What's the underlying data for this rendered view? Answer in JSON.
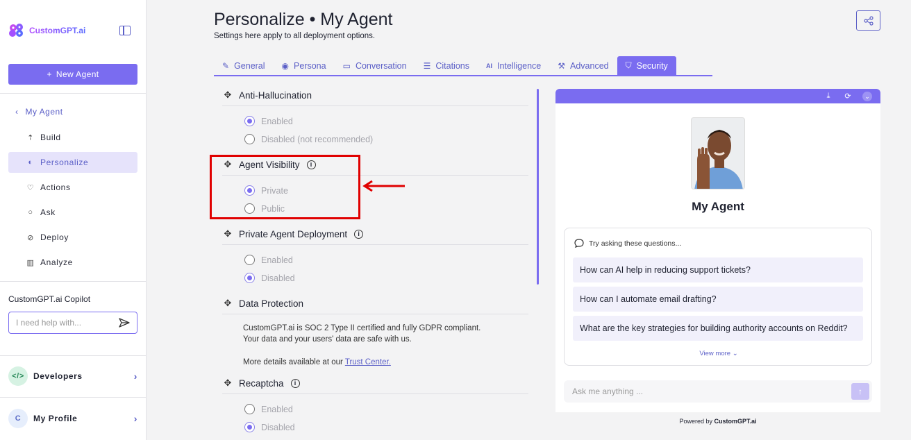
{
  "sidebar": {
    "logo_text": "CustomGPT.ai",
    "new_agent_label": "New Agent",
    "back_label": "My Agent",
    "nav": [
      {
        "label": "Build",
        "icon": "build-icon"
      },
      {
        "label": "Personalize",
        "icon": "palette-icon",
        "active": true
      },
      {
        "label": "Actions",
        "icon": "actions-icon"
      },
      {
        "label": "Ask",
        "icon": "chat-icon"
      },
      {
        "label": "Deploy",
        "icon": "link-icon"
      },
      {
        "label": "Analyze",
        "icon": "bar-chart-icon"
      }
    ],
    "copilot_title": "CustomGPT.ai Copilot",
    "copilot_placeholder": "I need help with...",
    "developers_label": "Developers",
    "profile_label": "My Profile",
    "profile_initial": "C"
  },
  "header": {
    "title": "Personalize • My Agent",
    "subtitle": "Settings here apply to all deployment options."
  },
  "tabs": [
    {
      "label": "General"
    },
    {
      "label": "Persona"
    },
    {
      "label": "Conversation"
    },
    {
      "label": "Citations"
    },
    {
      "label": "Intelligence"
    },
    {
      "label": "Advanced"
    },
    {
      "label": "Security",
      "active": true
    }
  ],
  "settings": {
    "anti_hallucination": {
      "title": "Anti-Hallucination",
      "options": [
        "Enabled",
        "Disabled (not recommended)"
      ],
      "selected": "Enabled"
    },
    "agent_visibility": {
      "title": "Agent Visibility",
      "options": [
        "Private",
        "Public"
      ],
      "selected": "Private"
    },
    "private_deployment": {
      "title": "Private Agent Deployment",
      "options": [
        "Enabled",
        "Disabled"
      ],
      "selected": "Disabled"
    },
    "data_protection": {
      "title": "Data Protection",
      "line1": "CustomGPT.ai is SOC 2 Type II certified and fully GDPR compliant.",
      "line2": "Your data and your users' data are safe with us.",
      "more_prefix": "More details available at our",
      "link_text": "Trust Center."
    },
    "recaptcha": {
      "title": "Recaptcha",
      "options": [
        "Enabled",
        "Disabled"
      ],
      "selected": "Disabled"
    }
  },
  "preview": {
    "agent_name": "My Agent",
    "questions_header": "Try asking these questions...",
    "questions": [
      "How can AI help in reducing support tickets?",
      "How can I automate email drafting?",
      "What are the key strategies for building authority accounts on Reddit?"
    ],
    "view_more": "View more",
    "input_placeholder": "Ask me anything ...",
    "powered_prefix": "Powered by",
    "powered_brand": "CustomGPT.ai"
  },
  "colors": {
    "accent": "#7a6cf0",
    "highlight": "#e00000"
  }
}
